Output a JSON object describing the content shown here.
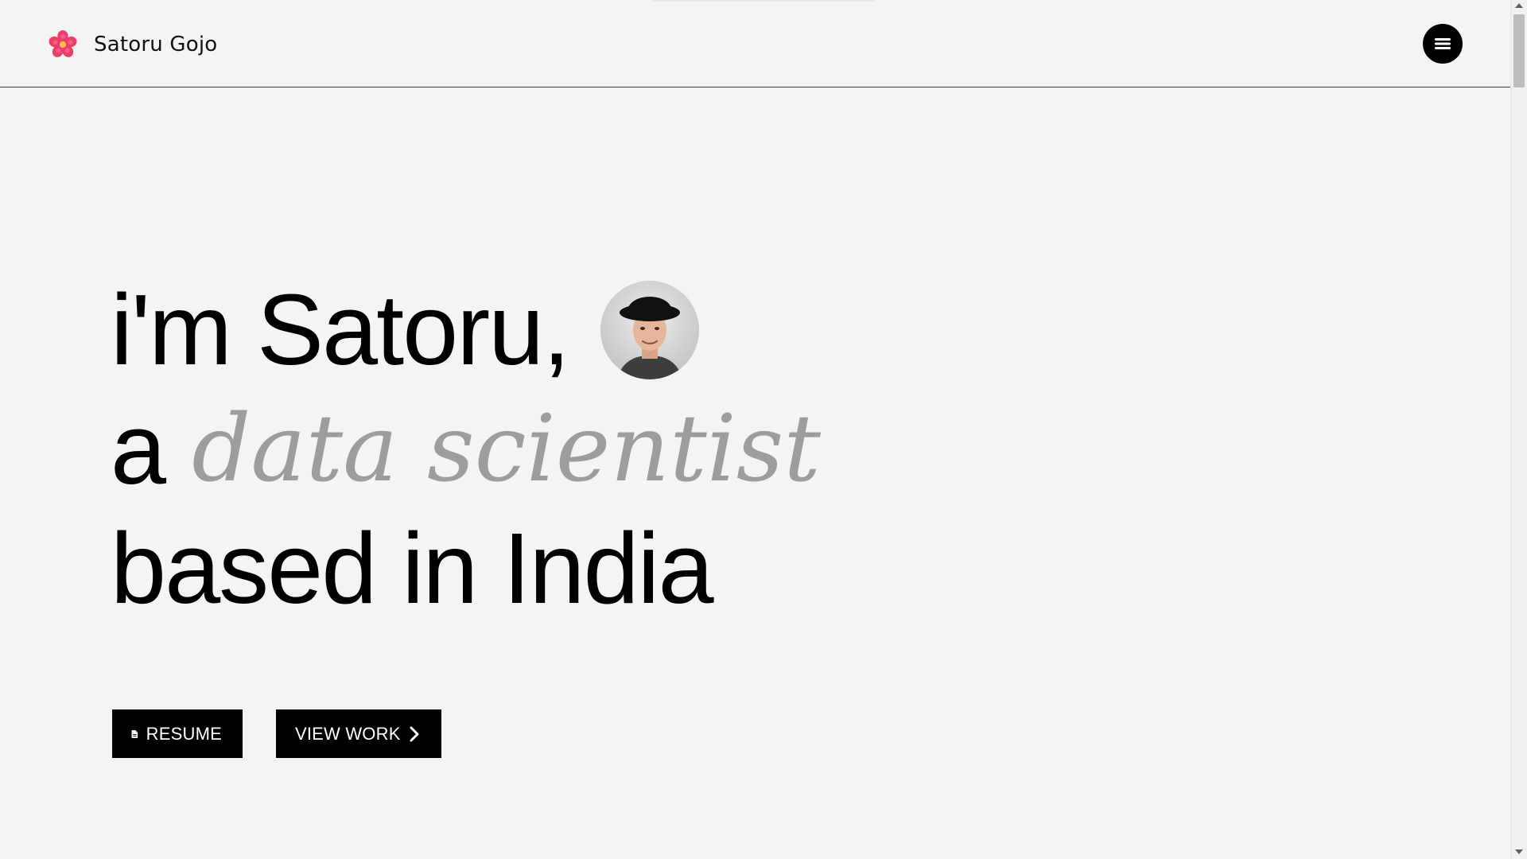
{
  "brand": {
    "name": "Satoru Gojo",
    "logo_icon": "flower-icon",
    "logo_colors": {
      "petals": "#ee3d6b",
      "center": "#f6c24b"
    }
  },
  "header": {
    "menu_icon": "hamburger-icon"
  },
  "hero": {
    "line1": "i'm Satoru,",
    "line2_prefix": "a",
    "line2_role": "data scientist",
    "line3": "based in India",
    "role_color": "#9d9d9d",
    "avatar_icon": "profile-photo"
  },
  "actions": {
    "resume_label": "RESUME",
    "resume_icon": "document-icon",
    "view_work_label": "VIEW WORK",
    "view_work_icon": "chevron-right-icon"
  },
  "colors": {
    "background": "#f4f4f4",
    "primary": "#000000",
    "button_text": "#ffffff"
  }
}
